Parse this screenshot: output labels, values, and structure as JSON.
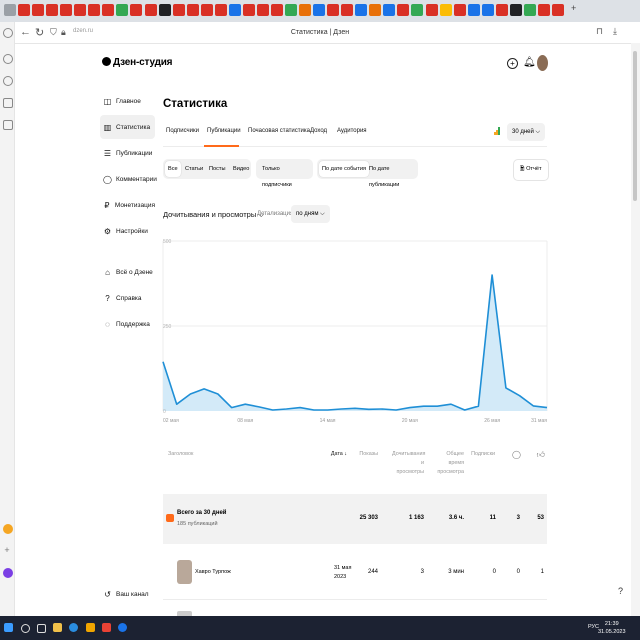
{
  "browser": {
    "url": "dzen.ru",
    "page_title": "Статистика | Дзен",
    "tab_colors": [
      "#9aa0a6",
      "#d93025",
      "#d93025",
      "#d93025",
      "#d93025",
      "#d93025",
      "#d93025",
      "#d93025",
      "#34a853",
      "#d93025",
      "#d93025",
      "#202124",
      "#d93025",
      "#d93025",
      "#d93025",
      "#d93025",
      "#1a73e8",
      "#d93025",
      "#d93025",
      "#d93025",
      "#34a853",
      "#e8710a",
      "#1a73e8",
      "#d93025",
      "#d93025",
      "#1a73e8",
      "#e8710a",
      "#1a73e8",
      "#d93025",
      "#34a853",
      "#d93025",
      "#fbbc04",
      "#d93025",
      "#1a73e8",
      "#1a73e8",
      "#d93025",
      "#202124",
      "#34a853",
      "#d93025",
      "#d93025"
    ]
  },
  "brand": {
    "logo_text": "Дзен-студия",
    "accent": "#ff6a1a",
    "chart_color": "#1f8fd6"
  },
  "sidebar": {
    "items": [
      {
        "label": "Главное",
        "icon": "home-icon"
      },
      {
        "label": "Статистика",
        "icon": "bar-chart-icon"
      },
      {
        "label": "Публикации",
        "icon": "publications-icon"
      },
      {
        "label": "Комментарии",
        "icon": "comment-icon"
      },
      {
        "label": "Монетизация",
        "icon": "ruble-icon"
      },
      {
        "label": "Настройки",
        "icon": "gear-icon"
      },
      {
        "label": "Всё о Дзене",
        "icon": "info-icon"
      },
      {
        "label": "Справка",
        "icon": "help-icon"
      },
      {
        "label": "Поддержка",
        "icon": "support-icon"
      }
    ],
    "channel_label": "Ваш канал"
  },
  "main": {
    "title": "Статистика",
    "tabs": [
      "Подписчики",
      "Публикации",
      "Почасовая статистика",
      "Доход",
      "Аудитория"
    ],
    "period": "30 дней",
    "filters_type": [
      "Все",
      "Статьи",
      "Посты",
      "Видео"
    ],
    "filter_subscribers": "Только подписчики",
    "filter_date": [
      "По дате события",
      "По дате публикации"
    ],
    "report_button": "Отчёт",
    "chart_metric": "Дочитывания и просмотры",
    "detail_label": "Детализация",
    "detail_value": "по дням"
  },
  "chart_data": {
    "type": "area",
    "y_ticks": [
      "500",
      "250",
      "0"
    ],
    "ylim": [
      0,
      500
    ],
    "x_tick_labels": [
      "02 мая",
      "08 мая",
      "14 мая",
      "20 мая",
      "26 мая",
      "31 мая"
    ],
    "values": [
      145,
      20,
      50,
      65,
      50,
      10,
      20,
      12,
      3,
      6,
      10,
      3,
      3,
      6,
      8,
      5,
      6,
      3,
      10,
      14,
      14,
      20,
      3,
      14,
      400,
      68,
      45,
      15,
      10
    ],
    "grid": true
  },
  "table": {
    "headers": {
      "title": "Заголовок",
      "date": "Дата ↓",
      "shows": "Показы",
      "reads": "Дочитывания и просмотры",
      "time": "Общее время просмотра",
      "subs": "Подписки",
      "comments_icon": "comment-icon",
      "likes_icon": "like-icon"
    },
    "total": {
      "label": "Всего за 30 дней",
      "sub": "185 публикаций",
      "shows": "25 303",
      "reads": "1 163",
      "time": "3.6 ч.",
      "subs": "11",
      "comments": "3",
      "likes": "53"
    },
    "rows": [
      {
        "title": "Хавро Турпож",
        "date_line1": "31 мая",
        "date_line2": "2023",
        "shows": "244",
        "reads": "3",
        "time": "3 мин",
        "subs": "0",
        "comments": "0",
        "likes": "1"
      }
    ]
  },
  "taskbar": {
    "time": "21:39",
    "date": "31.05.2023",
    "lang": "РУС"
  }
}
